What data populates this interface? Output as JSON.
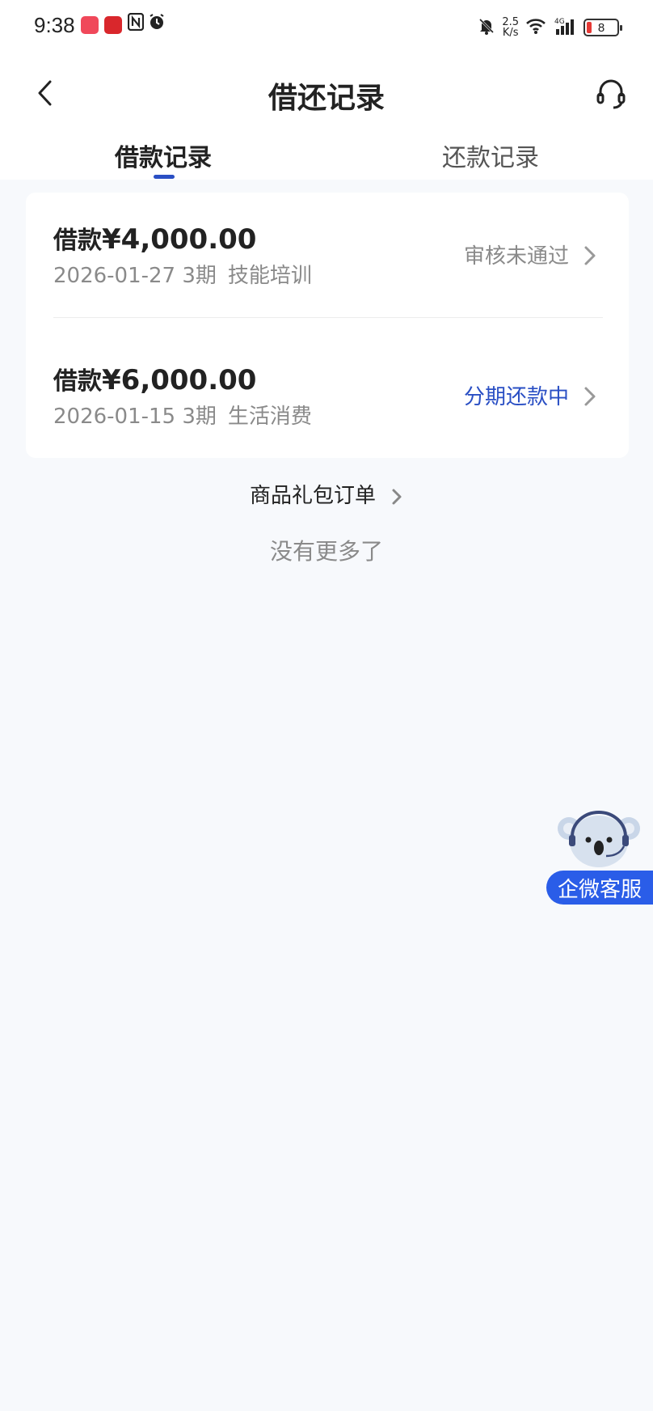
{
  "status_bar": {
    "time": "9:38",
    "net_speed_top": "2.5",
    "net_speed_bottom": "K/s",
    "battery": "8",
    "icons": [
      "app-icon-red",
      "app-icon-red-2",
      "nfc-icon",
      "alarm-icon",
      "mute-icon",
      "wifi-icon",
      "signal-4g-icon",
      "battery-icon"
    ]
  },
  "header": {
    "title": "借还记录",
    "back_icon": "chevron-left-icon",
    "support_icon": "headset-icon"
  },
  "tabs": [
    {
      "label": "借款记录",
      "active": true
    },
    {
      "label": "还款记录",
      "active": false
    }
  ],
  "records": [
    {
      "amount_label": "借款",
      "amount": "¥4,000.00",
      "date": "2026-01-27",
      "term": "3期",
      "purpose": "技能培训",
      "status": "审核未通过",
      "status_color": "#8a8a8a"
    },
    {
      "amount_label": "借款",
      "amount": "¥6,000.00",
      "date": "2026-01-15",
      "term": "3期",
      "purpose": "生活消费",
      "status": "分期还款中",
      "status_color": "#2a4fc4"
    }
  ],
  "gift_link": "商品礼包订单",
  "end_text": "没有更多了",
  "floating_service": {
    "label": "企微客服",
    "icon": "koala-mascot-icon"
  },
  "colors": {
    "accent": "#2a4fc4",
    "background": "#f7f9fc",
    "service_button": "#2a5de8"
  }
}
